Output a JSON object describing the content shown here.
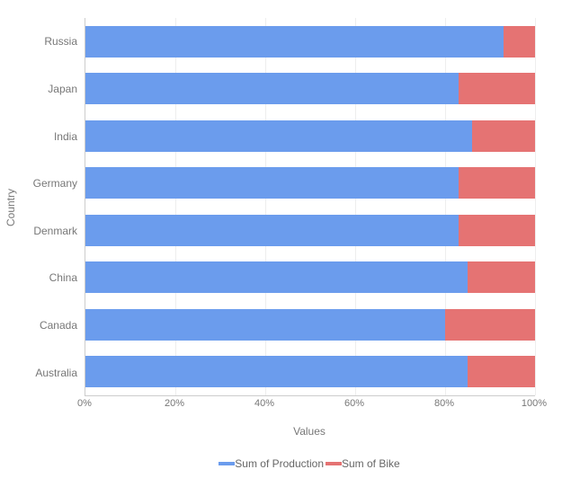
{
  "chart_data": {
    "type": "bar",
    "orientation": "horizontal",
    "stacked": "percent",
    "xlabel": "Values",
    "ylabel": "Country",
    "xticks": [
      "0%",
      "20%",
      "40%",
      "60%",
      "80%",
      "100%"
    ],
    "xlim": [
      0,
      100
    ],
    "categories": [
      "Russia",
      "Japan",
      "India",
      "Germany",
      "Denmark",
      "China",
      "Canada",
      "Australia"
    ],
    "series": [
      {
        "name": "Sum of Production",
        "color": "#6b9ced",
        "values": [
          93,
          83,
          86,
          83,
          83,
          85,
          80,
          85
        ]
      },
      {
        "name": "Sum of Bike",
        "color": "#e57373",
        "values": [
          7,
          17,
          14,
          17,
          17,
          15,
          20,
          15
        ]
      }
    ]
  }
}
